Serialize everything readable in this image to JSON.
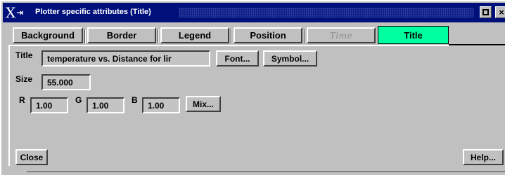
{
  "window": {
    "title": "Plotter specific attributes (Title)",
    "icons": {
      "app": "x-window-icon",
      "pin": "pin-icon",
      "maximize": "maximize-icon",
      "close": "close-icon"
    }
  },
  "tabs": [
    {
      "label": "Background",
      "state": "normal"
    },
    {
      "label": "Border",
      "state": "normal"
    },
    {
      "label": "Legend",
      "state": "normal"
    },
    {
      "label": "Position",
      "state": "normal"
    },
    {
      "label": "Time",
      "state": "disabled"
    },
    {
      "label": "Title",
      "state": "active"
    }
  ],
  "form": {
    "title_label": "Title",
    "title_value": "temperature vs. Distance for lir",
    "font_button": "Font...",
    "symbol_button": "Symbol...",
    "size_label": "Size",
    "size_value": "55.000",
    "r_label": "R",
    "r_value": "1.00",
    "g_label": "G",
    "g_value": "1.00",
    "b_label": "B",
    "b_value": "1.00",
    "mix_button": "Mix..."
  },
  "footer": {
    "close_button": "Close",
    "help_button": "Help..."
  },
  "colors": {
    "titlebar": "#00107a",
    "active_tab": "#00ff9e",
    "window_bg": "#c0c0c0"
  }
}
